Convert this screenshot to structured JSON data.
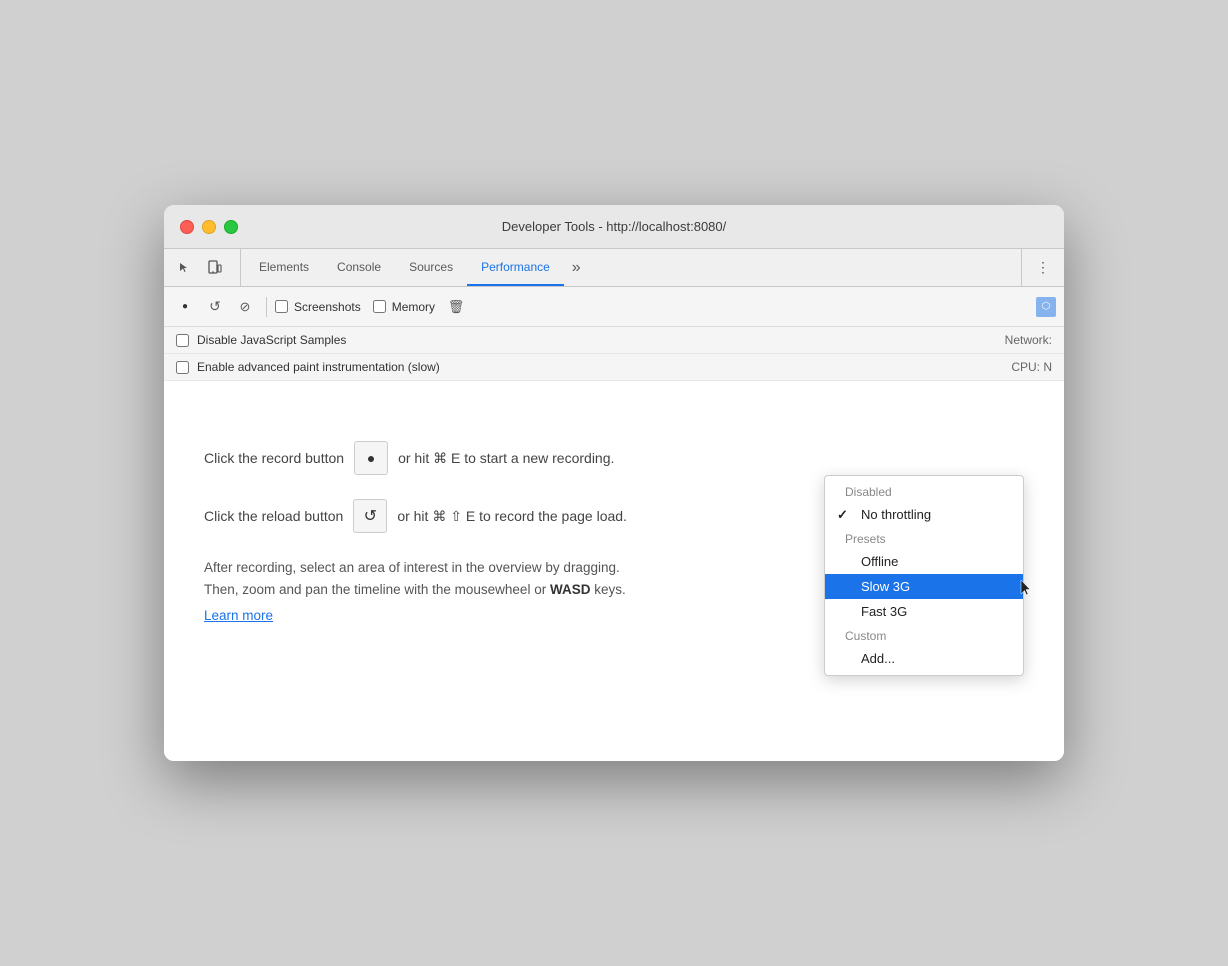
{
  "window": {
    "title": "Developer Tools - http://localhost:8080/"
  },
  "tabs": {
    "icons": [
      "cursor",
      "layers"
    ],
    "items": [
      {
        "label": "Elements",
        "active": false
      },
      {
        "label": "Console",
        "active": false
      },
      {
        "label": "Sources",
        "active": false
      },
      {
        "label": "Performance",
        "active": true
      }
    ],
    "more_label": "»",
    "menu_icon": "⋮"
  },
  "toolbar": {
    "record_btn": "▶",
    "refresh_btn": "↺",
    "cancel_btn": "⊘",
    "screenshots_label": "Screenshots",
    "memory_label": "Memory",
    "clear_btn": "🗑"
  },
  "settings": {
    "row1": {
      "label": "Disable JavaScript Samples",
      "right": "Network:"
    },
    "row2": {
      "label": "Enable advanced paint instrumentation (slow)",
      "right": "CPU: N"
    }
  },
  "main": {
    "instruction1_before": "Click the record button",
    "instruction1_after": "or hit ⌘ E to start a new recording.",
    "instruction2_before": "Click the reload button",
    "instruction2_after": "or hit ⌘ ⇧ E to record the page load.",
    "info_line1": "After recording, select an area of interest in the overview by dragging.",
    "info_line2": "Then, zoom and pan the timeline with the mousewheel or",
    "info_bold": "WASD",
    "info_line3": " keys.",
    "learn_more": "Learn more"
  },
  "dropdown": {
    "section1_header": "Disabled",
    "item_no_throttling": "No throttling",
    "item_no_throttling_checked": true,
    "section2_header": "Presets",
    "item_offline": "Offline",
    "item_slow3g": "Slow 3G",
    "item_slow3g_selected": true,
    "item_fast3g": "Fast 3G",
    "section3_header": "Custom",
    "item_add": "Add..."
  },
  "colors": {
    "active_tab": "#1a73e8",
    "selected_menu": "#1a73e8",
    "traffic_close": "#ff5f57",
    "traffic_min": "#ffbd2e",
    "traffic_max": "#28c840"
  }
}
